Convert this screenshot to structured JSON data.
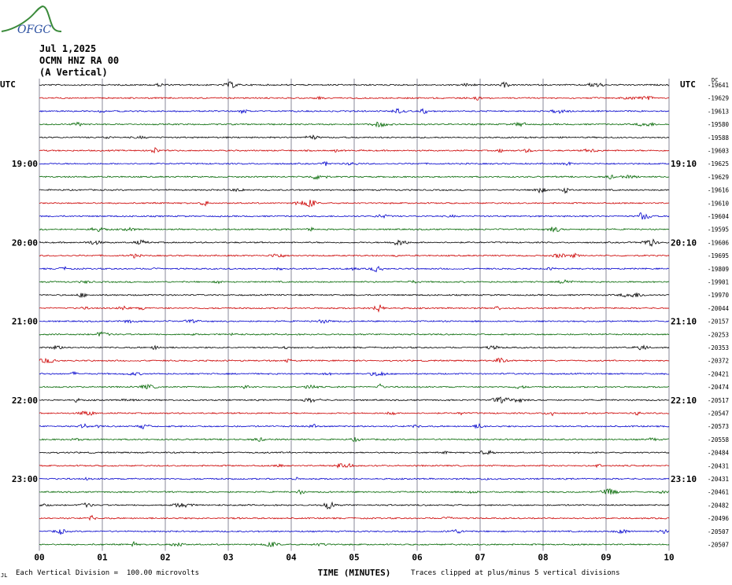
{
  "header": {
    "logo_text": "OFGC",
    "date": "Jul 1,2025",
    "station": "OCMN HNZ RA 00",
    "component": "(A Vertical)",
    "left_tz": "UTC",
    "right_tz": "UTC",
    "dc_label": "DC"
  },
  "footer": {
    "scale_note": "Each Vertical Division =  100.00 microvolts",
    "clip_note": "Traces clipped at plus/minus 5 vertical divisions",
    "corner_mark": "JL"
  },
  "chart_data": {
    "type": "line",
    "title": "",
    "xlabel": "TIME (MINUTES)",
    "ylabel": "",
    "x_ticks": [
      "00",
      "01",
      "02",
      "03",
      "04",
      "05",
      "06",
      "07",
      "08",
      "09",
      "10"
    ],
    "xlim": [
      0,
      10
    ],
    "grid": true,
    "trace_colors": [
      "#000000",
      "#cc0000",
      "#0000cc",
      "#006600"
    ],
    "left_time_labels": [
      {
        "row": 6,
        "label": "19:00"
      },
      {
        "row": 12,
        "label": "20:00"
      },
      {
        "row": 18,
        "label": "21:00"
      },
      {
        "row": 24,
        "label": "22:00"
      },
      {
        "row": 30,
        "label": "23:00"
      }
    ],
    "right_time_labels": [
      {
        "row": 6,
        "label": "19:10"
      },
      {
        "row": 12,
        "label": "20:10"
      },
      {
        "row": 18,
        "label": "21:10"
      },
      {
        "row": 24,
        "label": "22:10"
      },
      {
        "row": 30,
        "label": "23:10"
      }
    ],
    "dc_offsets": [
      -19641,
      -19629,
      -19613,
      -19580,
      -19588,
      -19603,
      -19625,
      -19629,
      -19616,
      -19610,
      -19604,
      -19595,
      -19606,
      -19695,
      -19809,
      -19901,
      -19970,
      -20044,
      -20157,
      -20253,
      -20353,
      -20372,
      -20421,
      -20474,
      -20517,
      -20547,
      -20573,
      -20558,
      -20484,
      -20431,
      -20431,
      -20461,
      -20482,
      -20496,
      -20507,
      -20507
    ]
  }
}
